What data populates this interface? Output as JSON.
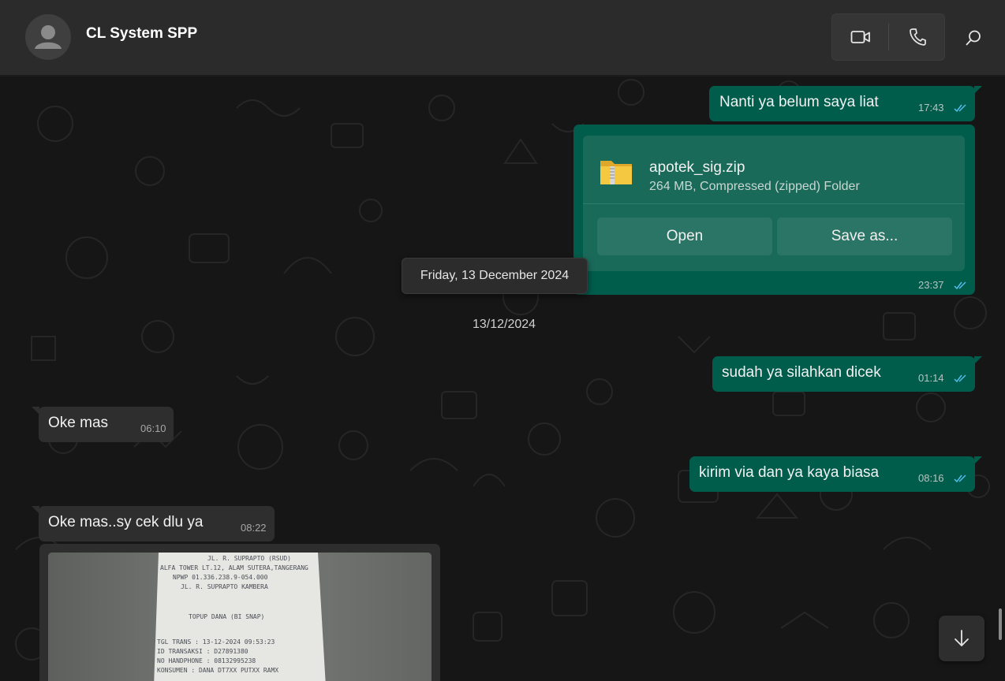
{
  "header": {
    "contact_name": "CL System SPP",
    "icons": {
      "avatar": "person-icon",
      "video": "video-call-icon",
      "voice": "phone-icon",
      "search": "search-icon"
    }
  },
  "messages": {
    "m1": {
      "text": "Nanti ya belum saya liat",
      "time": "17:43",
      "status": "read"
    },
    "file": {
      "name": "apotek_sig.zip",
      "meta": "264 MB, Compressed (zipped) Folder",
      "open_label": "Open",
      "save_label": "Save as...",
      "time": "23:37",
      "status": "read",
      "icon": "zip-folder-icon"
    },
    "date_tooltip": "Friday, 13 December 2024",
    "date_separator": "13/12/2024",
    "m2": {
      "text": "sudah ya silahkan dicek",
      "time": "01:14",
      "status": "read"
    },
    "m3": {
      "text": "Oke mas",
      "time": "06:10"
    },
    "m4": {
      "text": "kirim via dan ya kaya biasa",
      "time": "08:16",
      "status": "read"
    },
    "m5": {
      "text": "Oke mas..sy cek dlu ya",
      "time": "08:22"
    },
    "image": {
      "receipt_lines": [
        "JL. R. SUPRAPTO (RSUD)",
        "ALFA TOWER LT.12, ALAM SUTERA,TANGERANG",
        "NPWP 01.336.238.9-054.000",
        "JL. R. SUPRAPTO KAMBERA",
        "TOPUP DANA (BI SNAP)",
        "TGL TRANS     : 13-12-2024 09:53:23",
        "ID TRANSAKSI  : D27891380",
        "NO HANDPHONE  : 08132995238",
        "KONSUMEN      : DANA DT7XX PUTXX RAMX"
      ]
    }
  },
  "controls": {
    "scroll_down_icon": "arrow-down-icon"
  },
  "colors": {
    "outgoing": "#005c4b",
    "incoming": "#2e2e2e",
    "ticks": "#53bdeb"
  }
}
